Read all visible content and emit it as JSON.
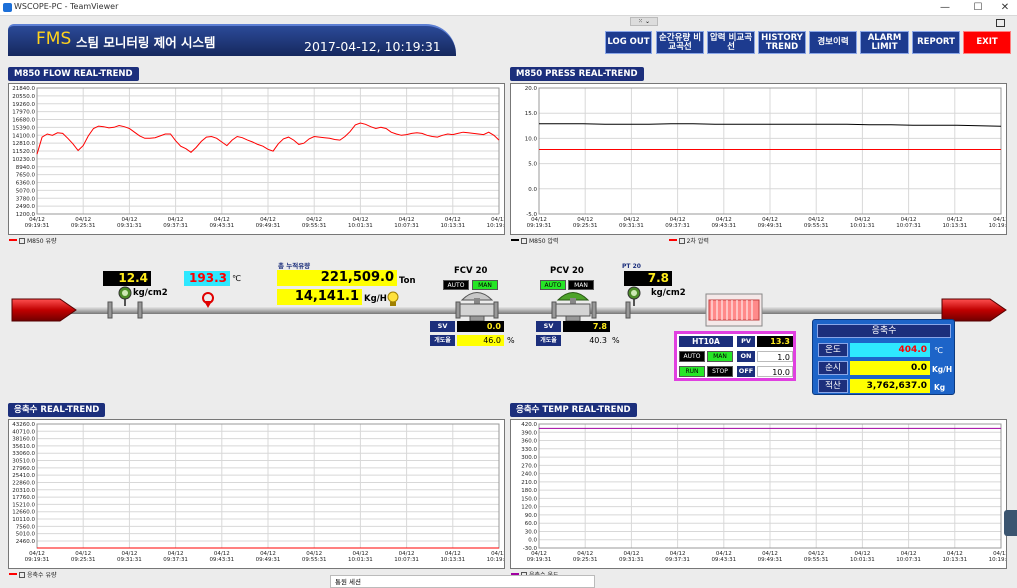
{
  "window": {
    "title": "WSCOPE-PC - TeamViewer"
  },
  "header": {
    "brand": "FMS",
    "title": "스팀 모니터링 제어 시스템",
    "datetime": "2017-04-12, 10:19:31"
  },
  "nav": [
    {
      "id": "logout",
      "label": "LOG OUT"
    },
    {
      "id": "inst-flow",
      "label": "순간유량 비교곡선"
    },
    {
      "id": "press-cmp",
      "label": "압력 비교곡선"
    },
    {
      "id": "history",
      "label": "HISTORY TREND"
    },
    {
      "id": "alarm-hist",
      "label": "경보이력"
    },
    {
      "id": "alarm-limit",
      "label": "ALARM LIMIT"
    },
    {
      "id": "report",
      "label": "REPORT"
    },
    {
      "id": "exit",
      "label": "EXIT"
    }
  ],
  "time_ticks": [
    {
      "d": "04/12",
      "t": "09:19:31"
    },
    {
      "d": "04/12",
      "t": "09:25:31"
    },
    {
      "d": "04/12",
      "t": "09:31:31"
    },
    {
      "d": "04/12",
      "t": "09:37:31"
    },
    {
      "d": "04/12",
      "t": "09:43:31"
    },
    {
      "d": "04/12",
      "t": "09:49:31"
    },
    {
      "d": "04/12",
      "t": "09:55:31"
    },
    {
      "d": "04/12",
      "t": "10:01:31"
    },
    {
      "d": "04/12",
      "t": "10:07:31"
    },
    {
      "d": "04/12",
      "t": "10:13:31"
    },
    {
      "d": "04/12",
      "t": "10:19:31"
    }
  ],
  "chart_data": [
    {
      "id": "flow",
      "type": "line",
      "title": "M850 FLOW REAL-TREND",
      "yticks": [
        "21840.0",
        "20550.0",
        "19260.0",
        "17970.0",
        "16680.0",
        "15390.0",
        "14100.0",
        "12810.0",
        "11520.0",
        "10230.0",
        "8940.0",
        "7650.0",
        "6360.0",
        "5070.0",
        "3780.0",
        "2490.0",
        "1200.0"
      ],
      "ylim": [
        1200,
        21840
      ],
      "series": [
        {
          "name": "M850 유량",
          "color": "#ff0000",
          "values": [
            11000,
            13800,
            14300,
            14100,
            14500,
            14400,
            13600,
            12700,
            11600,
            12400,
            14000,
            15200,
            15600,
            15500,
            15300,
            15400,
            15700,
            15500,
            15200,
            14600,
            14000,
            13600,
            13600,
            13700,
            14000,
            14300,
            14300,
            13200,
            12300,
            11900,
            11300,
            12100,
            13100,
            13800,
            13900,
            13600,
            13000,
            12400,
            13300,
            13900,
            13700,
            13300,
            13000,
            12600,
            12300,
            11800,
            11500,
            12700,
            13500,
            13800,
            13300,
            12600,
            12800,
            13500,
            13900,
            13800,
            13700,
            13600,
            13400,
            13300,
            13900,
            14700,
            15800,
            16100,
            15900,
            15500,
            15200,
            15400,
            15200,
            14600,
            14300,
            14100,
            14200,
            14400,
            14500,
            14400,
            14100,
            13900,
            13800,
            14100,
            14300,
            14200,
            14400,
            14600,
            14500,
            14400,
            14300,
            14200,
            14600,
            14100,
            13300
          ]
        }
      ]
    },
    {
      "id": "press",
      "type": "line",
      "title": "M850 PRESS REAL-TREND",
      "yticks": [
        "20.0",
        "15.0",
        "10.0",
        "5.0",
        "0.0",
        "-5.0"
      ],
      "ylim": [
        -5,
        20
      ],
      "series": [
        {
          "name": "M850 압력",
          "color": "#000000",
          "values": [
            12.9,
            12.9,
            12.9,
            12.8,
            12.8,
            12.8,
            12.9,
            12.9,
            12.8,
            12.8,
            12.8,
            12.8,
            12.8,
            12.8,
            12.8,
            12.7,
            12.7,
            12.6,
            12.6,
            12.6,
            12.5,
            12.4
          ]
        },
        {
          "name": "2차 압력",
          "color": "#ff0000",
          "values": [
            7.8,
            7.8,
            7.8,
            7.8,
            7.8,
            7.8,
            7.8,
            7.8,
            7.8,
            7.8,
            7.8,
            7.8,
            7.8,
            7.8,
            7.8,
            7.8,
            7.8,
            7.8,
            7.8,
            7.8,
            7.8,
            7.8
          ]
        }
      ]
    },
    {
      "id": "cond",
      "type": "line",
      "title": "응축수 REAL-TREND",
      "yticks": [
        "43260.0",
        "40710.0",
        "38160.0",
        "35610.0",
        "33060.0",
        "30510.0",
        "27960.0",
        "25410.0",
        "22860.0",
        "20310.0",
        "17760.0",
        "15210.0",
        "12660.0",
        "10110.0",
        "7560.0",
        "5010.0",
        "2460.0"
      ],
      "ylim": [
        0,
        43260
      ],
      "series": [
        {
          "name": "응축수 유량",
          "color": "#ff0000",
          "values": [
            0,
            0,
            0,
            0,
            0,
            0,
            0,
            0,
            0,
            0,
            0
          ]
        }
      ]
    },
    {
      "id": "temp",
      "type": "line",
      "title": "응축수 TEMP REAL-TREND",
      "yticks": [
        "420.0",
        "390.0",
        "360.0",
        "330.0",
        "300.0",
        "270.0",
        "240.0",
        "210.0",
        "180.0",
        "150.0",
        "120.0",
        "90.0",
        "60.0",
        "30.0",
        "0.0",
        "-30.0"
      ],
      "ylim": [
        -30,
        420
      ],
      "series": [
        {
          "name": "응축수 온도",
          "color": "#a000a0",
          "values": [
            404,
            404,
            404,
            404,
            404,
            404,
            404,
            404,
            404,
            404,
            404
          ]
        }
      ]
    }
  ],
  "process": {
    "pressure1": {
      "value": "12.4",
      "unit": "kg/cm2"
    },
    "temp1": {
      "value": "193.3",
      "unit": "℃"
    },
    "total": {
      "label": "총 누적유량",
      "value": "221,509.0",
      "unit": "Ton"
    },
    "instant": {
      "value": "14,141.1",
      "unit": "Kg/H"
    },
    "fcv": {
      "title": "FCV 20",
      "auto": "AUTO",
      "man": "MAN",
      "sv_label": "SV",
      "sv": "0.0",
      "open_label": "개도율",
      "open": "46.0",
      "pct": "%"
    },
    "pcv": {
      "title": "PCV 20",
      "auto": "AUTO",
      "man": "MAN",
      "sv_label": "SV",
      "sv": "7.8",
      "open_label": "개도율",
      "open": "40.3",
      "pct": "%"
    },
    "pt": {
      "title": "PT 20",
      "value": "7.8",
      "unit": "kg/cm2"
    },
    "ht": {
      "title": "HT10A",
      "pv_label": "PV",
      "pv": "13.3",
      "auto": "AUTO",
      "man": "MAN",
      "on_label": "ON",
      "on": "1.0",
      "run": "RUN",
      "stop": "STOP",
      "off_label": "OFF",
      "off": "10.0"
    },
    "cond": {
      "title": "응축수",
      "temp_label": "온도",
      "temp": "404.0",
      "temp_unit": "℃",
      "inst_label": "순시",
      "inst": "0.0",
      "inst_unit": "Kg/H",
      "acc_label": "적산",
      "acc": "3,762,637.0",
      "acc_unit": "Kg"
    }
  },
  "session": {
    "label": "통원 세션"
  }
}
